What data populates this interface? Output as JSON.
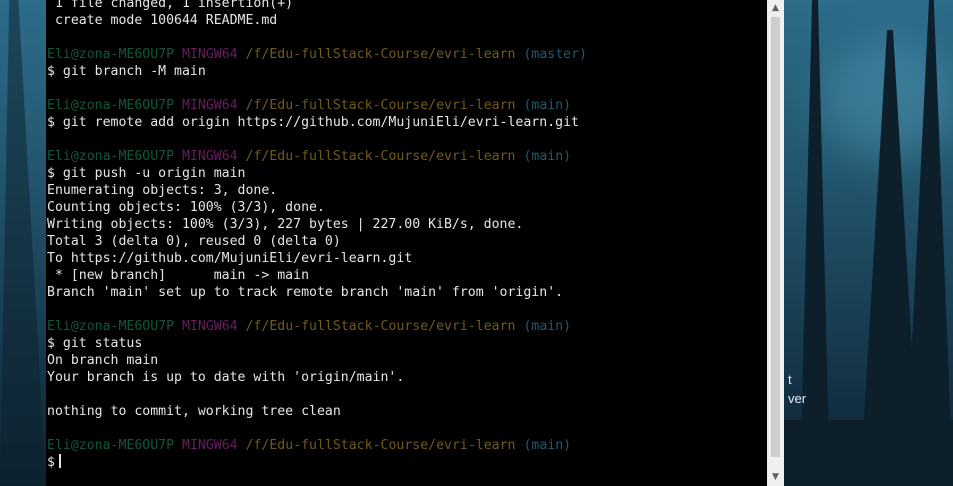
{
  "prompt": {
    "user": "Eli@zona-ME6OU7P",
    "system": "MINGW64",
    "path": "/f/Edu-fullStack-Course/evri-learn"
  },
  "lines": [
    {
      "kind": "out",
      "text": " 1 file changed, 1 insertion(+)"
    },
    {
      "kind": "out",
      "text": " create mode 100644 README.md"
    },
    {
      "kind": "blank"
    },
    {
      "kind": "prompt",
      "branch": "(master)"
    },
    {
      "kind": "cmd",
      "text": "$ git branch -M main"
    },
    {
      "kind": "blank"
    },
    {
      "kind": "prompt",
      "branch": "(main)"
    },
    {
      "kind": "cmd",
      "text": "$ git remote add origin https://github.com/MujuniEli/evri-learn.git"
    },
    {
      "kind": "blank"
    },
    {
      "kind": "prompt",
      "branch": "(main)"
    },
    {
      "kind": "cmd",
      "text": "$ git push -u origin main"
    },
    {
      "kind": "out",
      "text": "Enumerating objects: 3, done."
    },
    {
      "kind": "out",
      "text": "Counting objects: 100% (3/3), done."
    },
    {
      "kind": "out",
      "text": "Writing objects: 100% (3/3), 227 bytes | 227.00 KiB/s, done."
    },
    {
      "kind": "out",
      "text": "Total 3 (delta 0), reused 0 (delta 0)"
    },
    {
      "kind": "out",
      "text": "To https://github.com/MujuniEli/evri-learn.git"
    },
    {
      "kind": "out",
      "text": " * [new branch]      main -> main"
    },
    {
      "kind": "out",
      "text": "Branch 'main' set up to track remote branch 'main' from 'origin'."
    },
    {
      "kind": "blank"
    },
    {
      "kind": "prompt",
      "branch": "(main)"
    },
    {
      "kind": "cmd",
      "text": "$ git status"
    },
    {
      "kind": "out",
      "text": "On branch main"
    },
    {
      "kind": "out",
      "text": "Your branch is up to date with 'origin/main'."
    },
    {
      "kind": "blank"
    },
    {
      "kind": "out",
      "text": "nothing to commit, working tree clean"
    },
    {
      "kind": "blank"
    },
    {
      "kind": "prompt",
      "branch": "(main)"
    },
    {
      "kind": "input",
      "text": "$"
    }
  ],
  "scrollbar": {
    "up_icon": "scroll-up-arrow",
    "down_icon": "scroll-down-arrow"
  },
  "desktop_text": [
    "t",
    "ver"
  ]
}
